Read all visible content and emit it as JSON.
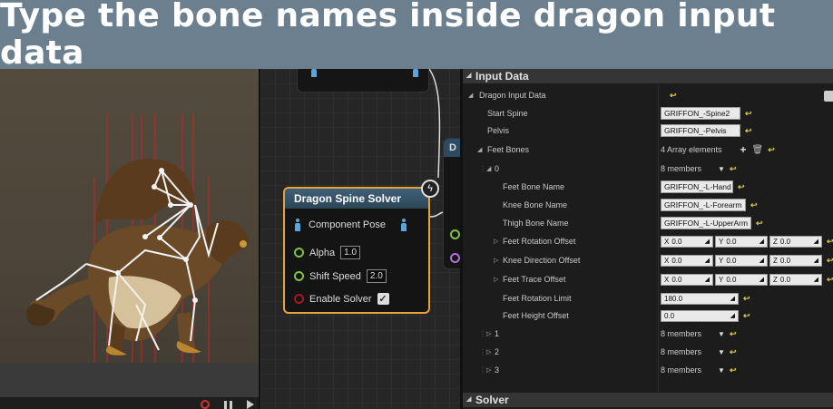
{
  "banner": {
    "title": "Type the bone names inside dragon input data"
  },
  "solver_node": {
    "title": "Dragon Spine Solver",
    "component_pose": "Component Pose",
    "alpha_label": "Alpha",
    "alpha_value": "1.0",
    "shift_label": "Shift Speed",
    "shift_value": "2.0",
    "enable_label": "Enable Solver",
    "enable_checked": "✓"
  },
  "side_node": {
    "title_letter": "D"
  },
  "details": {
    "category": "Input Data",
    "group": "Dragon Input Data",
    "start_spine_label": "Start Spine",
    "start_spine_value": "GRIFFON_-Spine2",
    "pelvis_label": "Pelvis",
    "pelvis_value": "GRIFFON_-Pelvis",
    "feet_bones_label": "Feet Bones",
    "feet_bones_value": "4 Array elements",
    "element0_label": "0",
    "element0_value": "8 members",
    "feet_bone_label": "Feet Bone Name",
    "feet_bone_value": "GRIFFON_-L-Hand",
    "knee_bone_label": "Knee Bone Name",
    "knee_bone_value": "GRIFFON_-L-Forearm",
    "thigh_bone_label": "Thigh Bone Name",
    "thigh_bone_value": "GRIFFON_-L-UpperArm",
    "rot_offset_label": "Feet Rotation Offset",
    "knee_dir_label": "Knee Direction Offset",
    "trace_offset_label": "Feet Trace Offset",
    "vec_x_label": "X",
    "vec_y_label": "Y",
    "vec_z_label": "Z",
    "vec_value": "0.0",
    "rot_limit_label": "Feet Rotation Limit",
    "rot_limit_value": "180.0",
    "height_offset_label": "Feet Height Offset",
    "height_offset_value": "0.0",
    "element1_label": "1",
    "element2_label": "2",
    "element3_label": "3",
    "members_value": "8 members",
    "solver_category": "Solver"
  },
  "colors": {
    "banner": "#6b7f8f",
    "node_border": "#e8a33a",
    "pin_green": "#7fc04a",
    "pin_red": "#9c1d1d"
  }
}
